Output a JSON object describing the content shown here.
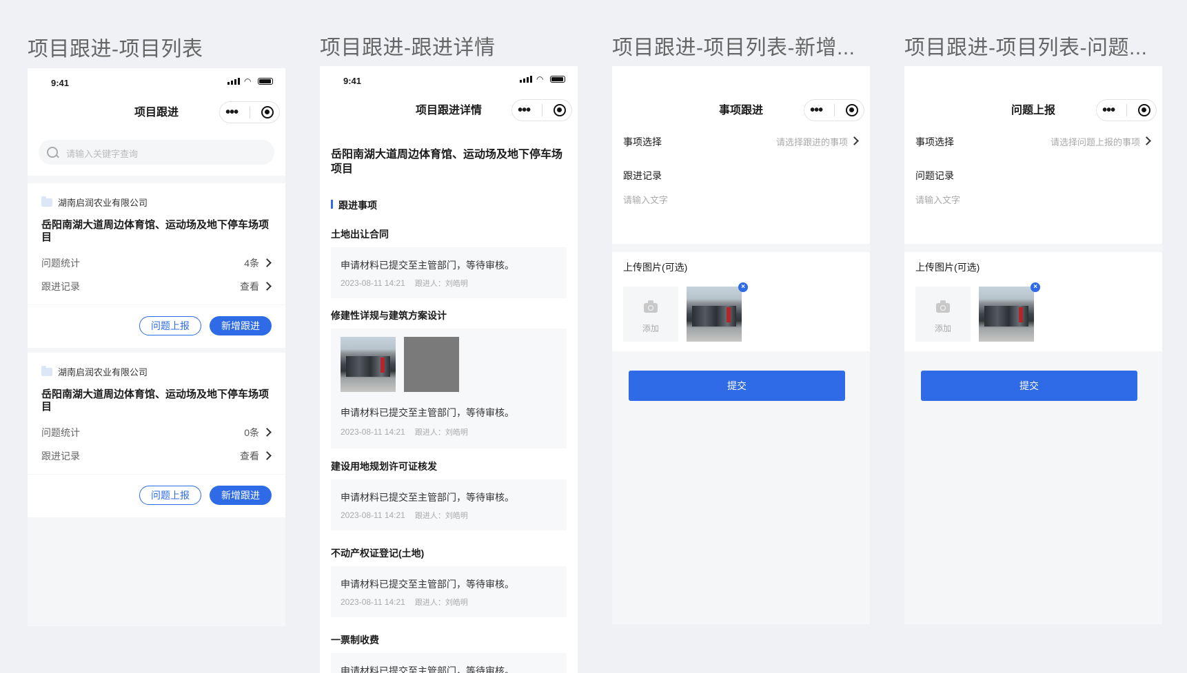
{
  "boards": {
    "list": "项目跟进-项目列表",
    "detail": "项目跟进-跟进详情",
    "add": "项目跟进-项目列表-新增...",
    "issue": "项目跟进-项目列表-问题..."
  },
  "status_time": "9:41",
  "list_screen": {
    "nav_title": "项目跟进",
    "search_placeholder": "请输入关键字查询",
    "cards": [
      {
        "company": "湖南启润农业有限公司",
        "project": "岳阳南湖大道周边体育馆、运动场及地下停车场项目",
        "issue_label": "问题统计",
        "issue_value": "4条",
        "record_label": "跟进记录",
        "record_value": "查看",
        "btn_issue": "问题上报",
        "btn_add": "新增跟进"
      },
      {
        "company": "湖南启润农业有限公司",
        "project": "岳阳南湖大道周边体育馆、运动场及地下停车场项目",
        "issue_label": "问题统计",
        "issue_value": "0条",
        "record_label": "跟进记录",
        "record_value": "查看",
        "btn_issue": "问题上报",
        "btn_add": "新增跟进"
      }
    ]
  },
  "detail_screen": {
    "nav_title": "项目跟进详情",
    "project_title": "岳阳南湖大道周边体育馆、运动场及地下停车场项目",
    "section_title": "跟进事项",
    "items": [
      {
        "title": "土地出让合同",
        "text": "申请材料已提交至主管部门，等待审核。",
        "time": "2023-08-11 14:21",
        "who": "跟进人：刘皓明"
      },
      {
        "title": "修建性详规与建筑方案设计",
        "text": "申请材料已提交至主管部门，等待审核。",
        "time": "2023-08-11 14:21",
        "who": "跟进人：刘皓明"
      },
      {
        "title": "建设用地规划许可证核发",
        "text": "申请材料已提交至主管部门，等待审核。",
        "time": "2023-08-11 14:21",
        "who": "跟进人：刘皓明"
      },
      {
        "title": "不动产权证登记(土地)",
        "text": "申请材料已提交至主管部门，等待审核。",
        "time": "2023-08-11 14:21",
        "who": "跟进人：刘皓明"
      },
      {
        "title": "一票制收费",
        "text": "申请材料已提交至主管部门，等待审核。"
      }
    ]
  },
  "add_screen": {
    "nav_title": "事项跟进",
    "select_label": "事项选择",
    "select_placeholder": "请选择跟进的事项",
    "record_label": "跟进记录",
    "record_placeholder": "请输入文字",
    "upload_label": "上传图片(可选)",
    "add_label": "添加",
    "submit": "提交"
  },
  "issue_screen": {
    "nav_title": "问题上报",
    "select_label": "事项选择",
    "select_placeholder": "请选择问题上报的事项",
    "record_label": "问题记录",
    "record_placeholder": "请输入文字",
    "upload_label": "上传图片(可选)",
    "add_label": "添加",
    "submit": "提交"
  },
  "colors": {
    "accent": "#2f6be6",
    "canvas": "#eff1f5"
  }
}
